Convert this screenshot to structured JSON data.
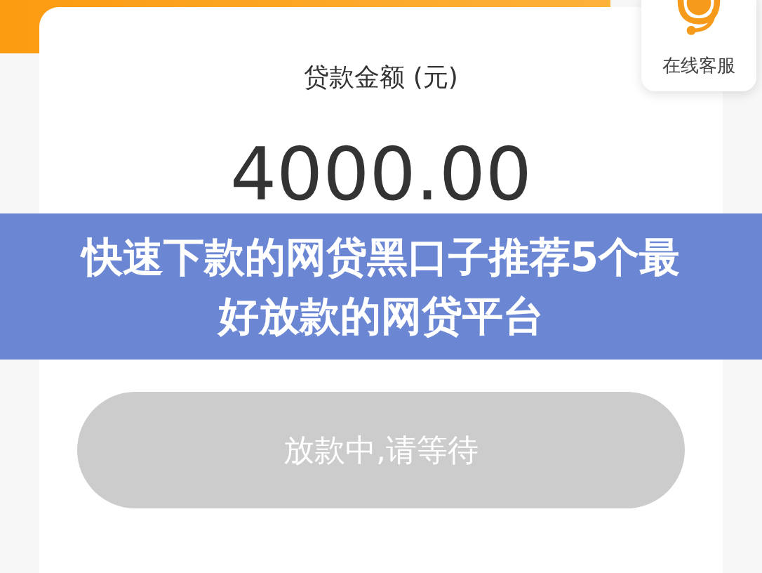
{
  "support_widget": {
    "label": "在线客服"
  },
  "loan_card": {
    "amount_label": "贷款金额 (元)",
    "amount": "4000.00"
  },
  "banner": {
    "title": "快速下款的网贷黑口子推荐5个最好放款的网贷平台"
  },
  "status_button": {
    "label": "放款中,请等待",
    "disabled": true
  }
}
